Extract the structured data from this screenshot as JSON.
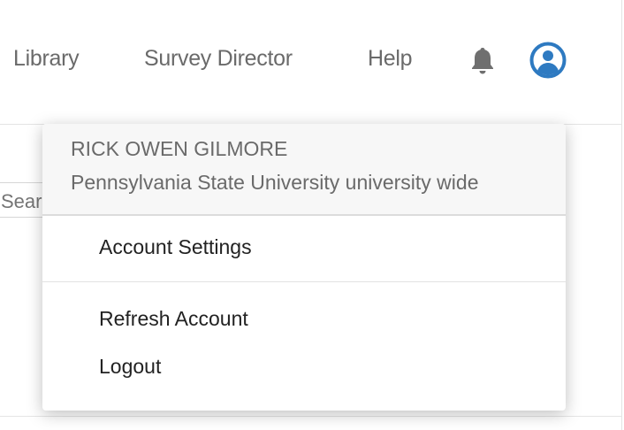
{
  "nav": {
    "library": "Library",
    "survey_director": "Survey Director",
    "help": "Help",
    "bell_icon": "bell-icon",
    "account_icon": "user-circle-icon",
    "accent": "#2e7ac1"
  },
  "search": {
    "placeholder": "Search"
  },
  "menu": {
    "user_name": "RICK OWEN GILMORE",
    "organization": "Pennsylvania State University university wide",
    "items": [
      {
        "label": "Account Settings"
      },
      {
        "label": "Refresh Account"
      },
      {
        "label": "Logout"
      }
    ]
  }
}
